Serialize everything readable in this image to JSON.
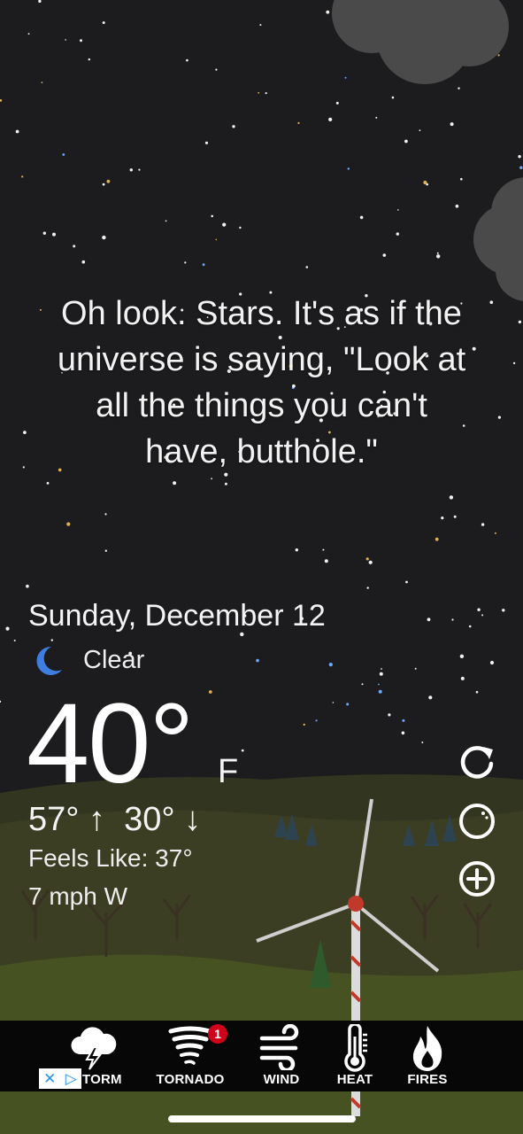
{
  "quote": {
    "lines": [
      "Oh look. Stars. It's as if the",
      "universe is saying, \"Look at",
      "all the things you can't",
      "have, butthole.\""
    ]
  },
  "weather": {
    "date": "Sunday, December 12",
    "condition": "Clear",
    "condition_icon": "moon-icon",
    "temperature": "40°",
    "unit": "F",
    "high": "57°",
    "low": "30°",
    "high_arrow": "↑",
    "low_arrow": "↓",
    "feels_like": "Feels Like: 37°",
    "wind": "7 mph W"
  },
  "side_actions": [
    {
      "name": "refresh-icon"
    },
    {
      "name": "theme-icon"
    },
    {
      "name": "add-location-icon"
    }
  ],
  "tabs": [
    {
      "label": "STORM",
      "visible_label": "TORM",
      "icon": "storm-icon"
    },
    {
      "label": "TORNADO",
      "icon": "tornado-icon",
      "badge": "1"
    },
    {
      "label": "WIND",
      "icon": "wind-icon"
    },
    {
      "label": "HEAT",
      "icon": "thermometer-icon"
    },
    {
      "label": "FIRES",
      "icon": "fire-icon"
    }
  ],
  "ad_choices": {
    "close": "✕",
    "play": "▷"
  },
  "colors": {
    "sky": "#1c1c1e",
    "hills": "#3c3f22",
    "moon": "#3d7ee0",
    "badge": "#d0021b",
    "tabbar": "#070707"
  }
}
